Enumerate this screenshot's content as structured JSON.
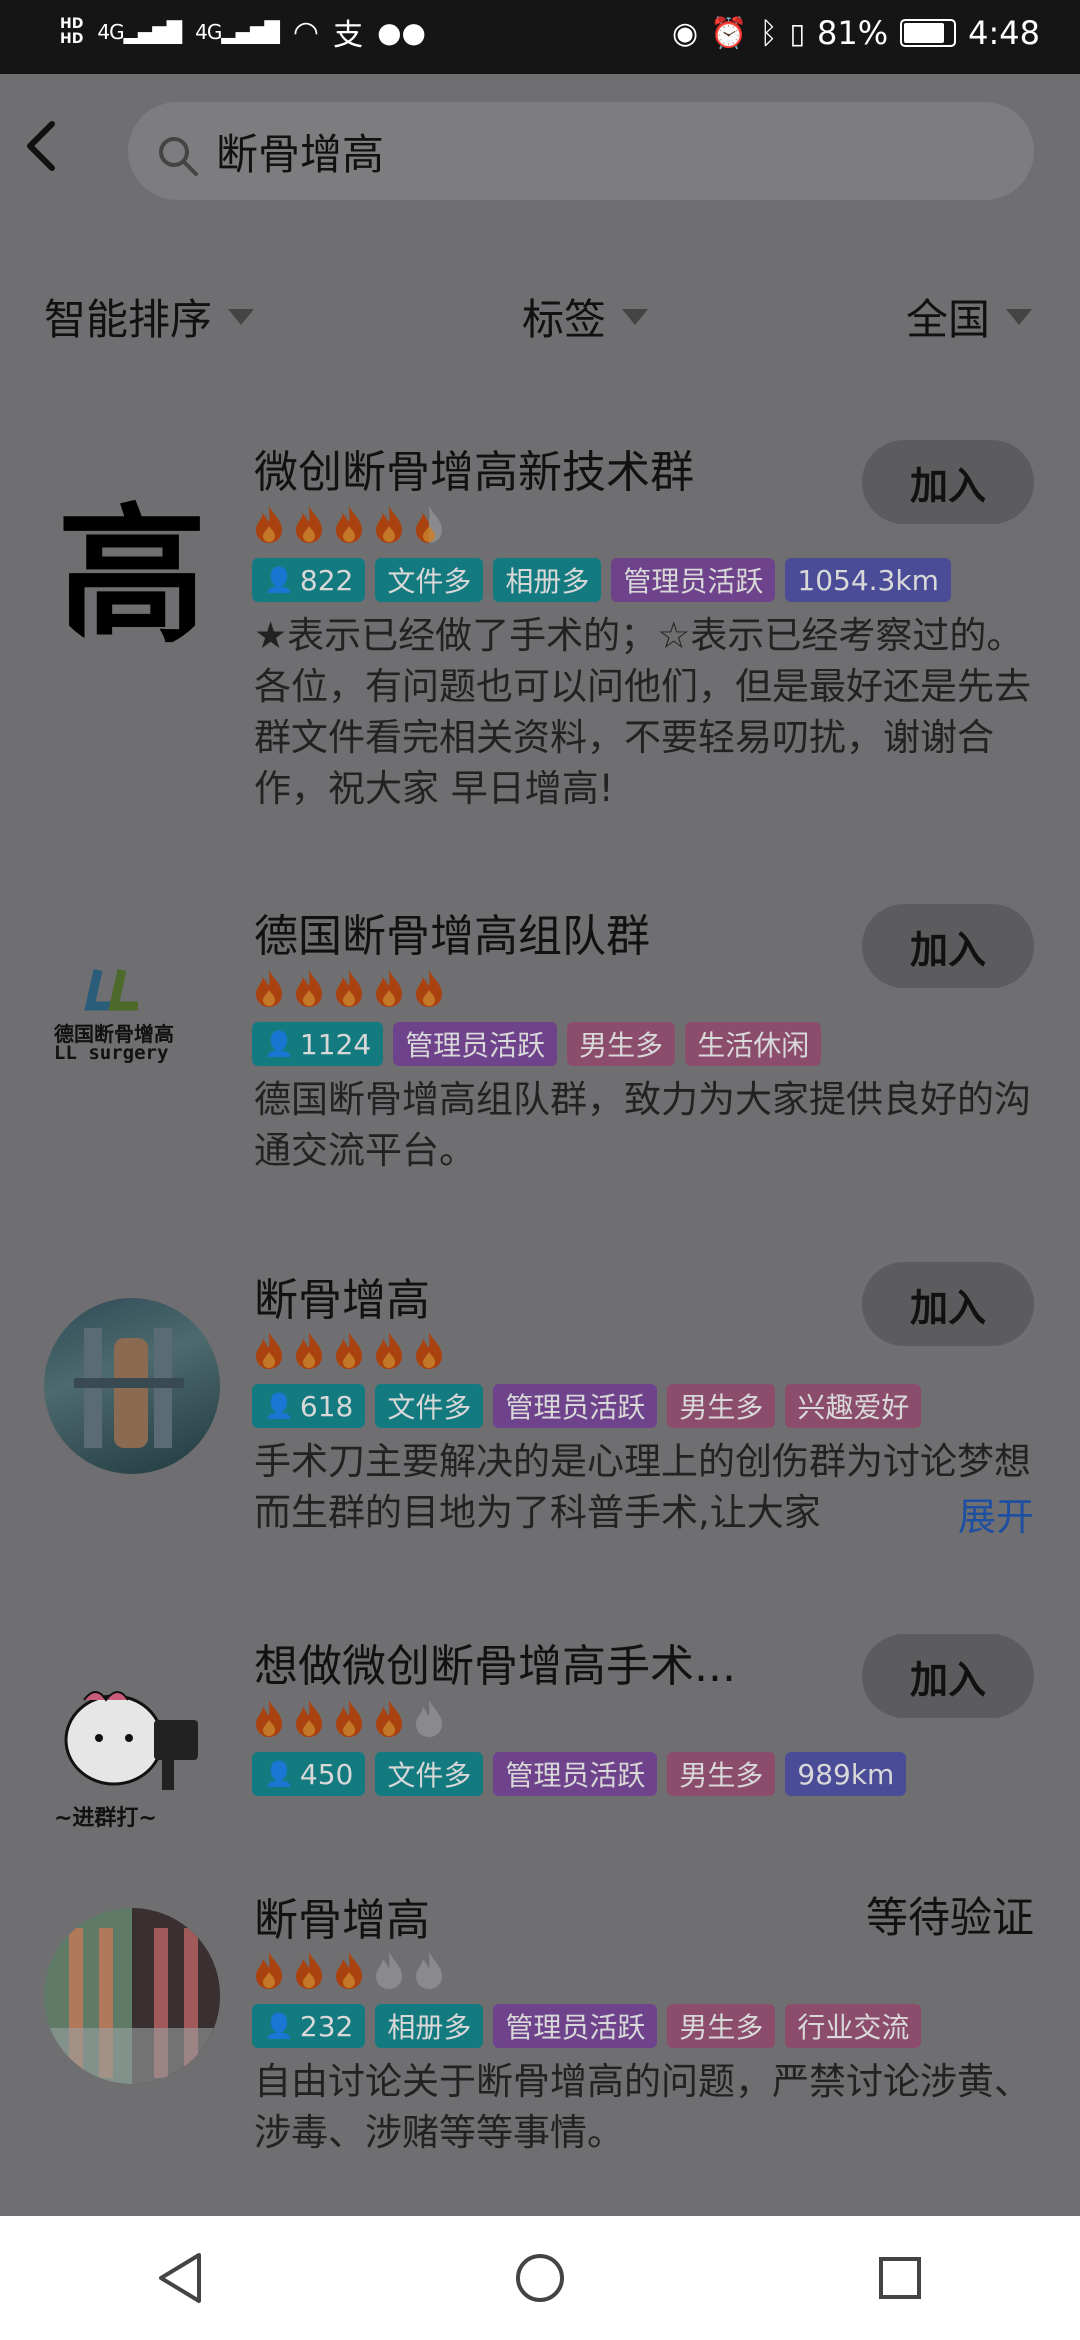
{
  "status": {
    "hd1": "HD",
    "hd2": "HD",
    "net1": "4G",
    "net2": "4G",
    "battery_percent": "81%",
    "time": "4:48"
  },
  "search": {
    "query": "断骨增高",
    "icon": "search-icon"
  },
  "filters": {
    "sort": "智能排序",
    "tags": "标签",
    "region": "全国"
  },
  "groups": [
    {
      "name": "微创断骨增高新技术群",
      "flames": 4.5,
      "action": "加入",
      "members": "822",
      "tags": [
        {
          "label": "文件多",
          "color": "teal"
        },
        {
          "label": "相册多",
          "color": "teal"
        },
        {
          "label": "管理员活跃",
          "color": "purple"
        },
        {
          "label": "1054.3km",
          "color": "blue"
        }
      ],
      "description": "★表示已经做了手术的；☆表示已经考察过的。各位，有问题也可以问他们，但是最好还是先去群文件看完相关资料，不要轻易叨扰，谢谢合作，祝大家 早日增高!",
      "avatar_text": "高"
    },
    {
      "name": "德国断骨增高组队群",
      "flames": 5,
      "action": "加入",
      "members": "1124",
      "tags": [
        {
          "label": "管理员活跃",
          "color": "purple"
        },
        {
          "label": "男生多",
          "color": "pink"
        },
        {
          "label": "生活休闲",
          "color": "pink"
        }
      ],
      "description": "德国断骨增高组队群，致力为大家提供良好的沟通交流平台。",
      "avatar_text": "德国断骨增高",
      "avatar_subtext": "LL surgery"
    },
    {
      "name": "断骨增高",
      "flames": 5,
      "action": "加入",
      "members": "618",
      "tags": [
        {
          "label": "文件多",
          "color": "teal"
        },
        {
          "label": "管理员活跃",
          "color": "purple"
        },
        {
          "label": "男生多",
          "color": "pink"
        },
        {
          "label": "兴趣爱好",
          "color": "pink"
        }
      ],
      "description": "手术刀主要解决的是心理上的创伤群为讨论梦想而生群的目地为了科普手术,让大家",
      "expand": "展开"
    },
    {
      "name": "想做微创断骨增高手术...",
      "flames": 4,
      "action": "加入",
      "members": "450",
      "tags": [
        {
          "label": "文件多",
          "color": "teal"
        },
        {
          "label": "管理员活跃",
          "color": "purple"
        },
        {
          "label": "男生多",
          "color": "pink"
        },
        {
          "label": "989km",
          "color": "blue"
        }
      ],
      "avatar_text": "~进群打~"
    },
    {
      "name": "断骨增高",
      "flames": 3,
      "status": "等待验证",
      "members": "232",
      "tags": [
        {
          "label": "相册多",
          "color": "teal"
        },
        {
          "label": "管理员活跃",
          "color": "purple"
        },
        {
          "label": "男生多",
          "color": "pink"
        },
        {
          "label": "行业交流",
          "color": "pink"
        }
      ],
      "description": "自由讨论关于断骨增高的问题，严禁讨论涉黄、涉毒、涉赌等等事情。"
    }
  ]
}
